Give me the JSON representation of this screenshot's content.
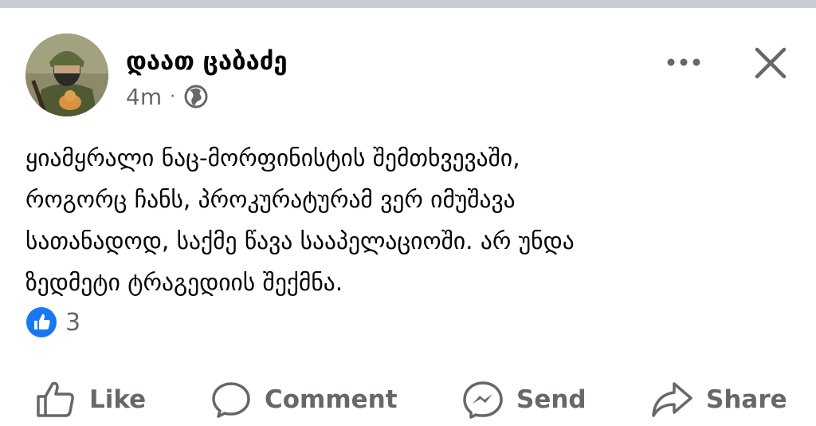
{
  "post": {
    "author": "დაათ ცაბაძე",
    "timestamp": "4m",
    "separator": "·",
    "privacy_icon": "globe-icon",
    "text_lines": [
      "ყიამყრალი ნაც-მორფინისტის შემთხვევაში,",
      "როგორც ჩანს, პროკურატურამ ვერ იმუშავა",
      "სათანადოდ, საქმე წავა სააპელაციოში. არ უნდა",
      "ზედმეტი ტრაგედიის შექმნა."
    ]
  },
  "reactions": {
    "icon": "like-reaction-icon",
    "count": "3"
  },
  "actions": {
    "like": "Like",
    "comment": "Comment",
    "send": "Send",
    "share": "Share"
  },
  "header_controls": {
    "more_icon": "more-options-icon",
    "close_icon": "close-icon"
  },
  "colors": {
    "text_primary": "#050505",
    "text_secondary": "#65676b",
    "like_blue": "#1877f2",
    "divider": "#c9ccd1"
  }
}
